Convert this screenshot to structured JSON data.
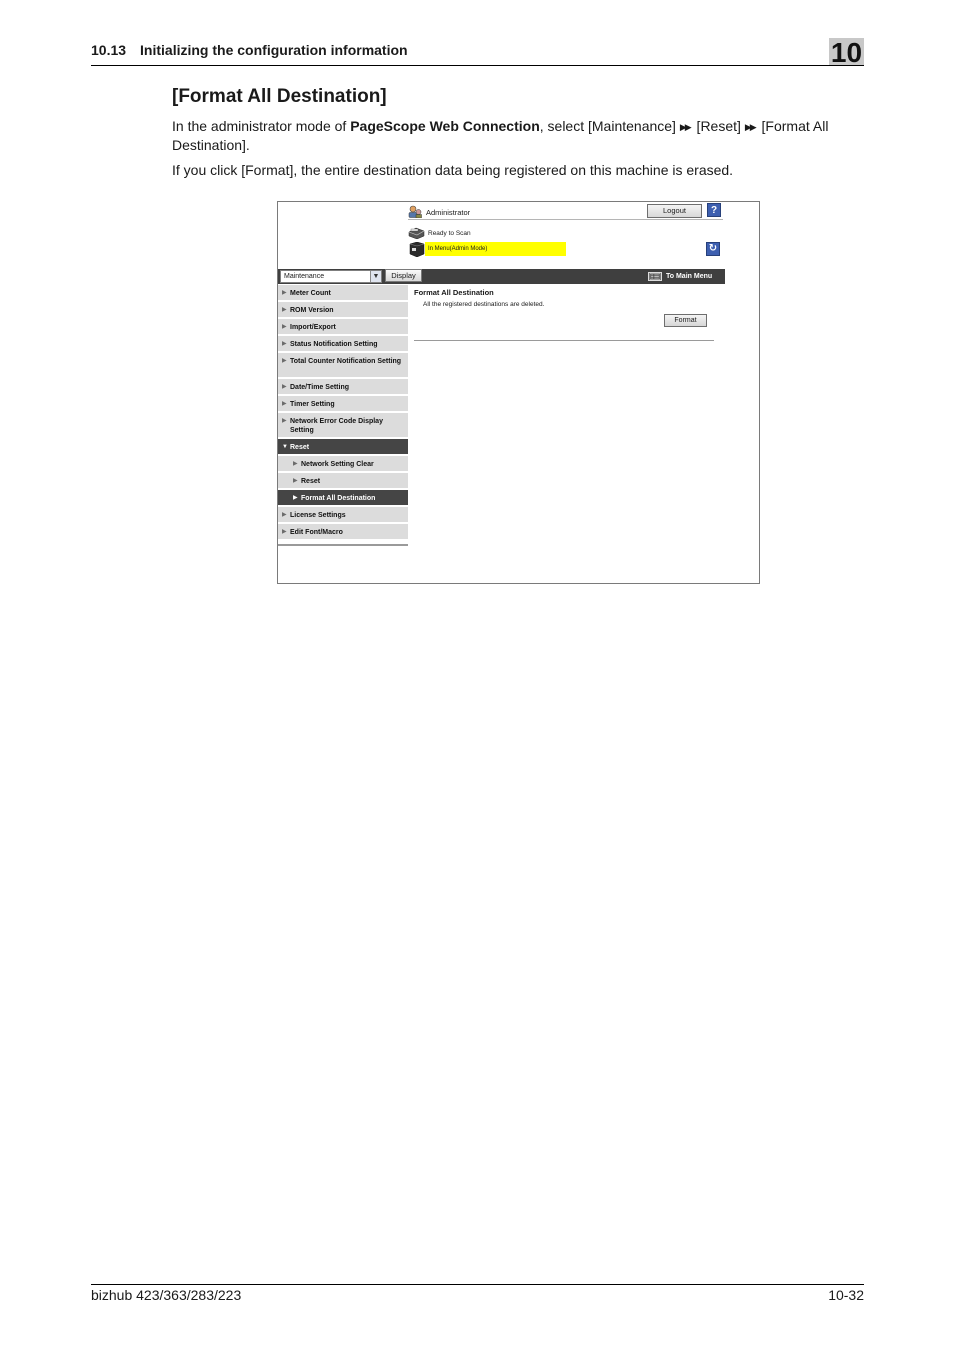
{
  "header": {
    "section_number": "10.13",
    "section_title": "Initializing the configuration information",
    "chapter": "10"
  },
  "section": {
    "title": "[Format All Destination]",
    "para1_a": "In the administrator mode of ",
    "para1_bold": "PageScope Web Connection",
    "para1_b": ", select [Maintenance] ",
    "para1_c": " [Reset] ",
    "para1_d": " [Format All Destination].",
    "para2": "If you click [Format], the entire destination data being registered on this machine is erased."
  },
  "screenshot": {
    "admin_label": "Administrator",
    "logout_label": "Logout",
    "help_label": "?",
    "ready_label": "Ready to Scan",
    "menu_status": "In Menu(Admin Mode)",
    "select_value": "Maintenance",
    "display_label": "Display",
    "main_menu_label": "To Main Menu",
    "sidebar": [
      {
        "label": "Meter Count"
      },
      {
        "label": "ROM Version"
      },
      {
        "label": "Import/Export"
      },
      {
        "label": "Status Notification Setting"
      },
      {
        "label": "Total Counter Notification Setting"
      },
      {
        "label": "Date/Time Setting"
      },
      {
        "label": "Timer Setting"
      },
      {
        "label": "Network Error Code Display Setting"
      },
      {
        "label": "Reset"
      },
      {
        "label": "Network Setting Clear"
      },
      {
        "label": "Reset"
      },
      {
        "label": "Format All Destination"
      },
      {
        "label": "License Settings"
      },
      {
        "label": "Edit Font/Macro"
      }
    ],
    "content_title": "Format All Destination",
    "content_desc": "All the registered destinations are deleted.",
    "format_label": "Format"
  },
  "footer": {
    "model": "bizhub 423/363/283/223",
    "page": "10-32"
  }
}
